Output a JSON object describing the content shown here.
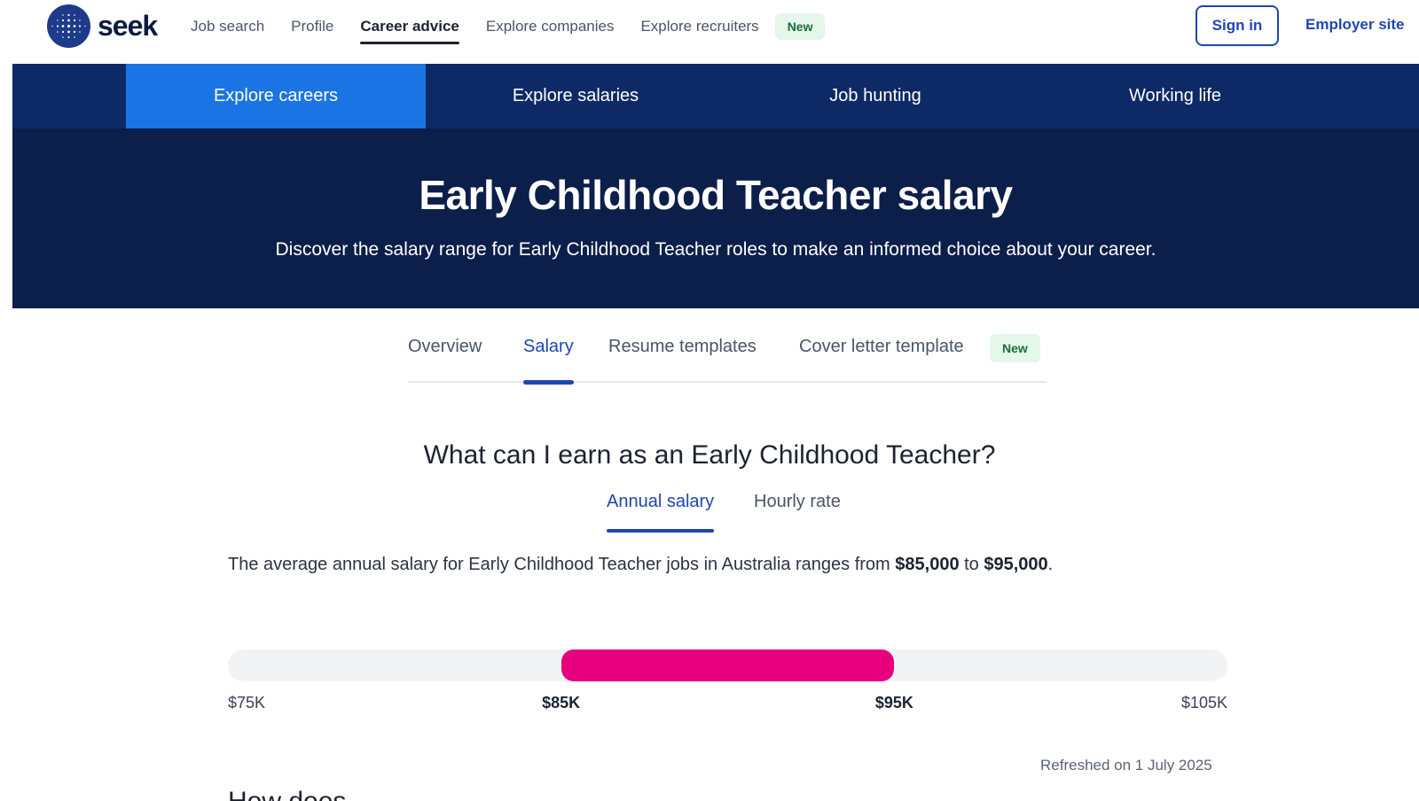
{
  "brand": {
    "logo_text": "seek",
    "accent": "#1e46b3",
    "pink": "#e6007e",
    "navy": "#0c1e4a"
  },
  "topnav": {
    "links": [
      "Job search",
      "Profile",
      "Career advice",
      "Explore companies",
      "Explore recruiters"
    ],
    "active_link": "Career advice",
    "new_badge": "New",
    "signin": "Sign in",
    "employer_site": "Employer site"
  },
  "subnav": {
    "items": [
      "Explore careers",
      "Explore salaries",
      "Job hunting",
      "Working life"
    ],
    "active": "Explore careers"
  },
  "hero": {
    "title": "Early Childhood Teacher salary",
    "subtitle": "Discover the salary range for Early Childhood Teacher roles to make an informed choice about your career."
  },
  "tabs": {
    "items": [
      "Overview",
      "Salary",
      "Resume templates",
      "Cover letter template"
    ],
    "active": "Salary",
    "new_badge": "New"
  },
  "salary": {
    "heading": "What can I earn as an Early Childhood Teacher?",
    "rate_tabs": [
      "Annual salary",
      "Hourly rate"
    ],
    "active_rate": "Annual salary",
    "summary_prefix": "The average annual salary for Early Childhood Teacher jobs in Australia ranges from ",
    "low": "$85,000",
    "summary_mid": " to ",
    "high": "$95,000",
    "summary_suffix": ".",
    "range": {
      "min": 75000,
      "max": 105000,
      "low": 85000,
      "high": 95000
    },
    "ticks": [
      "$75K",
      "$85K",
      "$95K",
      "$105K"
    ],
    "refreshed": "Refreshed on 1 July 2025"
  },
  "partial_heading": "How does..."
}
